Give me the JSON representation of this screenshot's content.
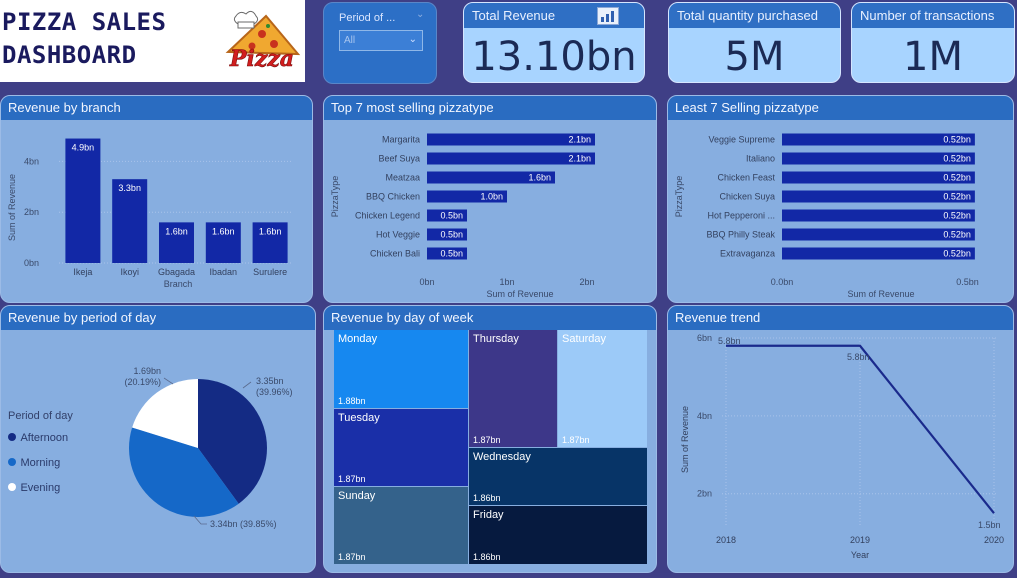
{
  "header": {
    "title": "PIZZA SALES\nDASHBOARD",
    "logo_text": "Pizza"
  },
  "filter": {
    "label": "Period of ...",
    "value": "All"
  },
  "kpis": {
    "revenue": {
      "title": "Total Revenue",
      "value": "13.10bn"
    },
    "quantity": {
      "title": "Total quantity purchased",
      "value": "5M"
    },
    "transactions": {
      "title": "Number of transactions",
      "value": "1M"
    }
  },
  "panels": {
    "branch": "Revenue by branch",
    "top7": "Top 7 most selling pizzatype",
    "least7": "Least 7 Selling pizzatype",
    "period": "Revenue by period of day",
    "dow": "Revenue by day of week",
    "trend": "Revenue trend"
  },
  "colors": {
    "bar": "#1228a6",
    "pie_afternoon": "#142b84",
    "pie_morning": "#1568c8",
    "pie_evening": "#ffffff"
  },
  "chart_data": [
    {
      "id": "branch",
      "type": "bar",
      "categories": [
        "Ikeja",
        "Ikoyi",
        "Gbagada",
        "Ibadan",
        "Surulere"
      ],
      "values": [
        4.9,
        3.3,
        1.6,
        1.6,
        1.6
      ],
      "labels": [
        "4.9bn",
        "3.3bn",
        "1.6bn",
        "1.6bn",
        "1.6bn"
      ],
      "xlabel": "Branch",
      "ylabel": "Sum of Revenue",
      "ylim": [
        0,
        5
      ],
      "yticks": [
        0,
        2,
        4
      ],
      "ytick_labels": [
        "0bn",
        "2bn",
        "4bn"
      ]
    },
    {
      "id": "top7",
      "type": "bar",
      "orientation": "horizontal",
      "categories": [
        "Margarita",
        "Beef Suya",
        "Meatzaa",
        "BBQ Chicken",
        "Chicken Legend",
        "Hot Veggie",
        "Chicken Bali"
      ],
      "values": [
        2.1,
        2.1,
        1.6,
        1.0,
        0.5,
        0.5,
        0.5
      ],
      "labels": [
        "2.1bn",
        "2.1bn",
        "1.6bn",
        "1.0bn",
        "0.5bn",
        "0.5bn",
        "0.5bn"
      ],
      "xlabel": "Sum of Revenue",
      "ylabel": "PizzaType",
      "xlim": [
        0,
        2.4
      ],
      "xticks": [
        0,
        1,
        2
      ],
      "xtick_labels": [
        "0bn",
        "1bn",
        "2bn"
      ]
    },
    {
      "id": "least7",
      "type": "bar",
      "orientation": "horizontal",
      "categories": [
        "Veggie Supreme",
        "Italiano",
        "Chicken Feast",
        "Chicken Suya",
        "Hot Pepperoni ...",
        "BBQ Philly Steak",
        "Extravaganza"
      ],
      "values": [
        0.52,
        0.52,
        0.52,
        0.52,
        0.52,
        0.52,
        0.52
      ],
      "labels": [
        "0.52bn",
        "0.52bn",
        "0.52bn",
        "0.52bn",
        "0.52bn",
        "0.52bn",
        "0.52bn"
      ],
      "xlabel": "Sum of Revenue",
      "ylabel": "PizzaType",
      "xlim": [
        0,
        0.55
      ],
      "xticks": [
        0,
        0.5
      ],
      "xtick_labels": [
        "0.0bn",
        "0.5bn"
      ]
    },
    {
      "id": "period",
      "type": "pie",
      "legend_title": "Period of day",
      "legend_placement": "left",
      "slices": [
        {
          "name": "Afternoon",
          "value": 39.96,
          "label": "3.35bn\n(39.96%)"
        },
        {
          "name": "Morning",
          "value": 39.85,
          "label": "3.34bn (39.85%)"
        },
        {
          "name": "Evening",
          "value": 20.19,
          "label": "1.69bn\n(20.19%)"
        }
      ]
    },
    {
      "id": "dow",
      "type": "heatmap",
      "subtype": "treemap",
      "cells": [
        {
          "name": "Monday",
          "value": 1.88,
          "label": "1.88bn",
          "color": "#1688f0"
        },
        {
          "name": "Tuesday",
          "value": 1.87,
          "label": "1.87bn",
          "color": "#1a2fa8"
        },
        {
          "name": "Sunday",
          "value": 1.87,
          "label": "1.87bn",
          "color": "#34628b"
        },
        {
          "name": "Thursday",
          "value": 1.87,
          "label": "1.87bn",
          "color": "#3d3789"
        },
        {
          "name": "Saturday",
          "value": 1.87,
          "label": "1.87bn",
          "color": "#9ccaf8"
        },
        {
          "name": "Wednesday",
          "value": 1.86,
          "label": "1.86bn",
          "color": "#073467"
        },
        {
          "name": "Friday",
          "value": 1.86,
          "label": "1.86bn",
          "color": "#061a3f"
        }
      ]
    },
    {
      "id": "trend",
      "type": "line",
      "x": [
        "2018",
        "2019",
        "2020"
      ],
      "y": [
        5.8,
        5.8,
        1.5
      ],
      "labels": [
        "5.8bn",
        "5.8bn",
        "1.5bn"
      ],
      "xlabel": "Year",
      "ylabel": "Sum of Revenue",
      "ylim": [
        1.3,
        6
      ],
      "yticks": [
        2,
        4,
        6
      ],
      "ytick_labels": [
        "2bn",
        "4bn",
        "6bn"
      ],
      "grid": true
    }
  ]
}
